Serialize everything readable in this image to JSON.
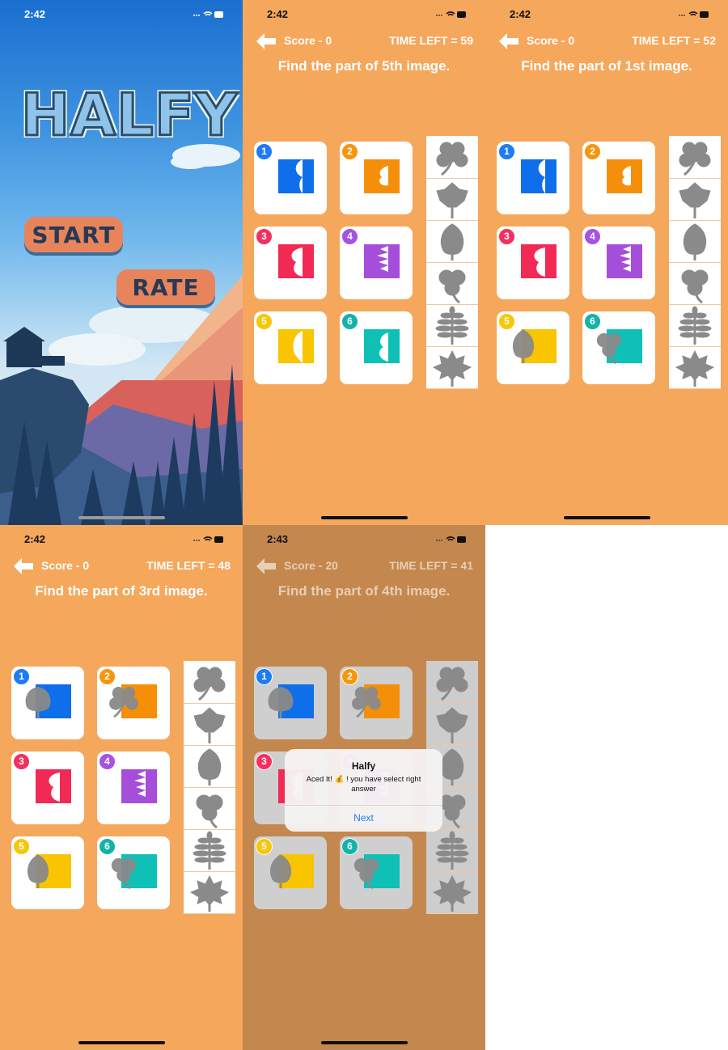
{
  "colors": {
    "game_bg": "#f5a75c",
    "badge": [
      "#1e7bf6",
      "#f5960e",
      "#f0315f",
      "#a553e0",
      "#f6c70a",
      "#14b3a9"
    ],
    "swatch": [
      "#0f6fea",
      "#f58f0a",
      "#f12a55",
      "#a54ed9",
      "#f9c400",
      "#0ec0b5"
    ],
    "silhouette": "#8a8a8a"
  },
  "title_screen": {
    "status_time": "2:42",
    "logo": "HALFY",
    "start_label": "START",
    "rate_label": "RATE"
  },
  "screens": [
    {
      "status_time": "2:42",
      "score": "Score - 0",
      "time_left": "TIME LEFT = 59",
      "prompt": "Find the part of 5th image.",
      "filled": [
        false,
        false,
        false,
        false,
        false,
        false
      ]
    },
    {
      "status_time": "2:42",
      "score": "Score - 0",
      "time_left": "TIME LEFT = 52",
      "prompt": "Find the part of 1st image.",
      "filled": [
        false,
        false,
        false,
        false,
        true,
        true
      ]
    },
    {
      "status_time": "2:42",
      "score": "Score - 0",
      "time_left": "TIME LEFT = 48",
      "prompt": "Find the part of 3rd image.",
      "filled": [
        true,
        true,
        false,
        false,
        true,
        true
      ]
    },
    {
      "status_time": "2:43",
      "score": "Score - 20",
      "time_left": "TIME LEFT = 41",
      "prompt": "Find the part of 4th image.",
      "filled": [
        true,
        true,
        false,
        false,
        true,
        true
      ]
    }
  ],
  "card_numbers": [
    "1",
    "2",
    "3",
    "4",
    "5",
    "6"
  ],
  "card_shapes": [
    "leaf-round-icon",
    "clover-four-icon",
    "clover-three-icon",
    "leaf-fern-icon",
    "leaf-oval-icon",
    "clover-three-icon"
  ],
  "strip_shapes": [
    "clover-four-icon",
    "leaf-ivy-icon",
    "leaf-oval-icon",
    "clover-three-icon",
    "leaf-fern-icon",
    "leaf-maple-icon"
  ],
  "alert": {
    "title": "Halfy",
    "message": "Aced It! 💰 ! you have select right answer",
    "button": "Next"
  }
}
